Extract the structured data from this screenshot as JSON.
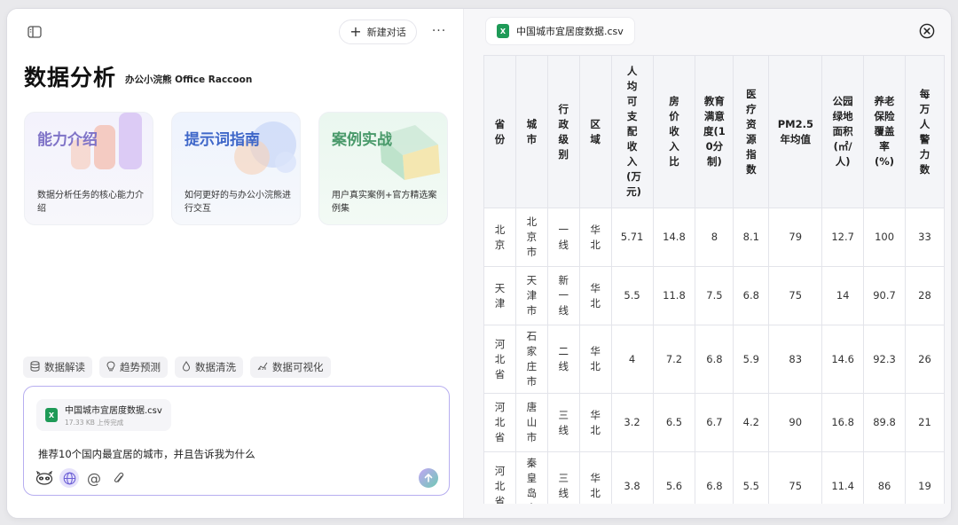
{
  "header": {
    "new_chat_label": "新建对话",
    "more_label": "···"
  },
  "page": {
    "title": "数据分析",
    "subtitle": "办公小浣熊 Office Raccoon"
  },
  "cards": [
    {
      "title": "能力介绍",
      "desc": "数据分析任务的核心能力介绍"
    },
    {
      "title": "提示词指南",
      "desc": "如何更好的与办公小浣熊进行交互"
    },
    {
      "title": "案例实战",
      "desc": "用户真实案例+官方精选案例集"
    }
  ],
  "chips": [
    {
      "label": "数据解读",
      "icon": "database-icon"
    },
    {
      "label": "趋势预测",
      "icon": "lightbulb-icon"
    },
    {
      "label": "数据清洗",
      "icon": "droplet-icon"
    },
    {
      "label": "数据可视化",
      "icon": "chart-icon"
    }
  ],
  "composer": {
    "file_name": "中国城市宜居度数据.csv",
    "file_meta": "17.33 KB 上传完成",
    "prompt": "推荐10个国内最宜居的城市，并且告诉我为什么"
  },
  "viewer": {
    "tab_name": "中国城市宜居度数据.csv",
    "columns": [
      "省份",
      "城市",
      "行政级别",
      "区域",
      "人均可支配收入(万元)",
      "房价收入比",
      "教育满意度(10分制)",
      "医疗资源指数",
      "PM2.5年均值",
      "公园绿地面积(㎡/人)",
      "养老保险覆盖率(%)",
      "每万人警力数"
    ],
    "rows": [
      [
        "北京",
        "北京市",
        "一线",
        "华北",
        "5.71",
        "14.8",
        "8",
        "8.1",
        "79",
        "12.7",
        "100",
        "33"
      ],
      [
        "天津",
        "天津市",
        "新一线",
        "华北",
        "5.5",
        "11.8",
        "7.5",
        "6.8",
        "75",
        "14",
        "90.7",
        "28"
      ],
      [
        "河北省",
        "石家庄市",
        "二线",
        "华北",
        "4",
        "7.2",
        "6.8",
        "5.9",
        "83",
        "14.6",
        "92.3",
        "26"
      ],
      [
        "河北省",
        "唐山市",
        "三线",
        "华北",
        "3.2",
        "6.5",
        "6.7",
        "4.2",
        "90",
        "16.8",
        "89.8",
        "21"
      ],
      [
        "河北省",
        "秦皇岛市",
        "三线",
        "华北",
        "3.8",
        "5.6",
        "6.8",
        "5.5",
        "75",
        "11.4",
        "86",
        "19"
      ]
    ]
  }
}
